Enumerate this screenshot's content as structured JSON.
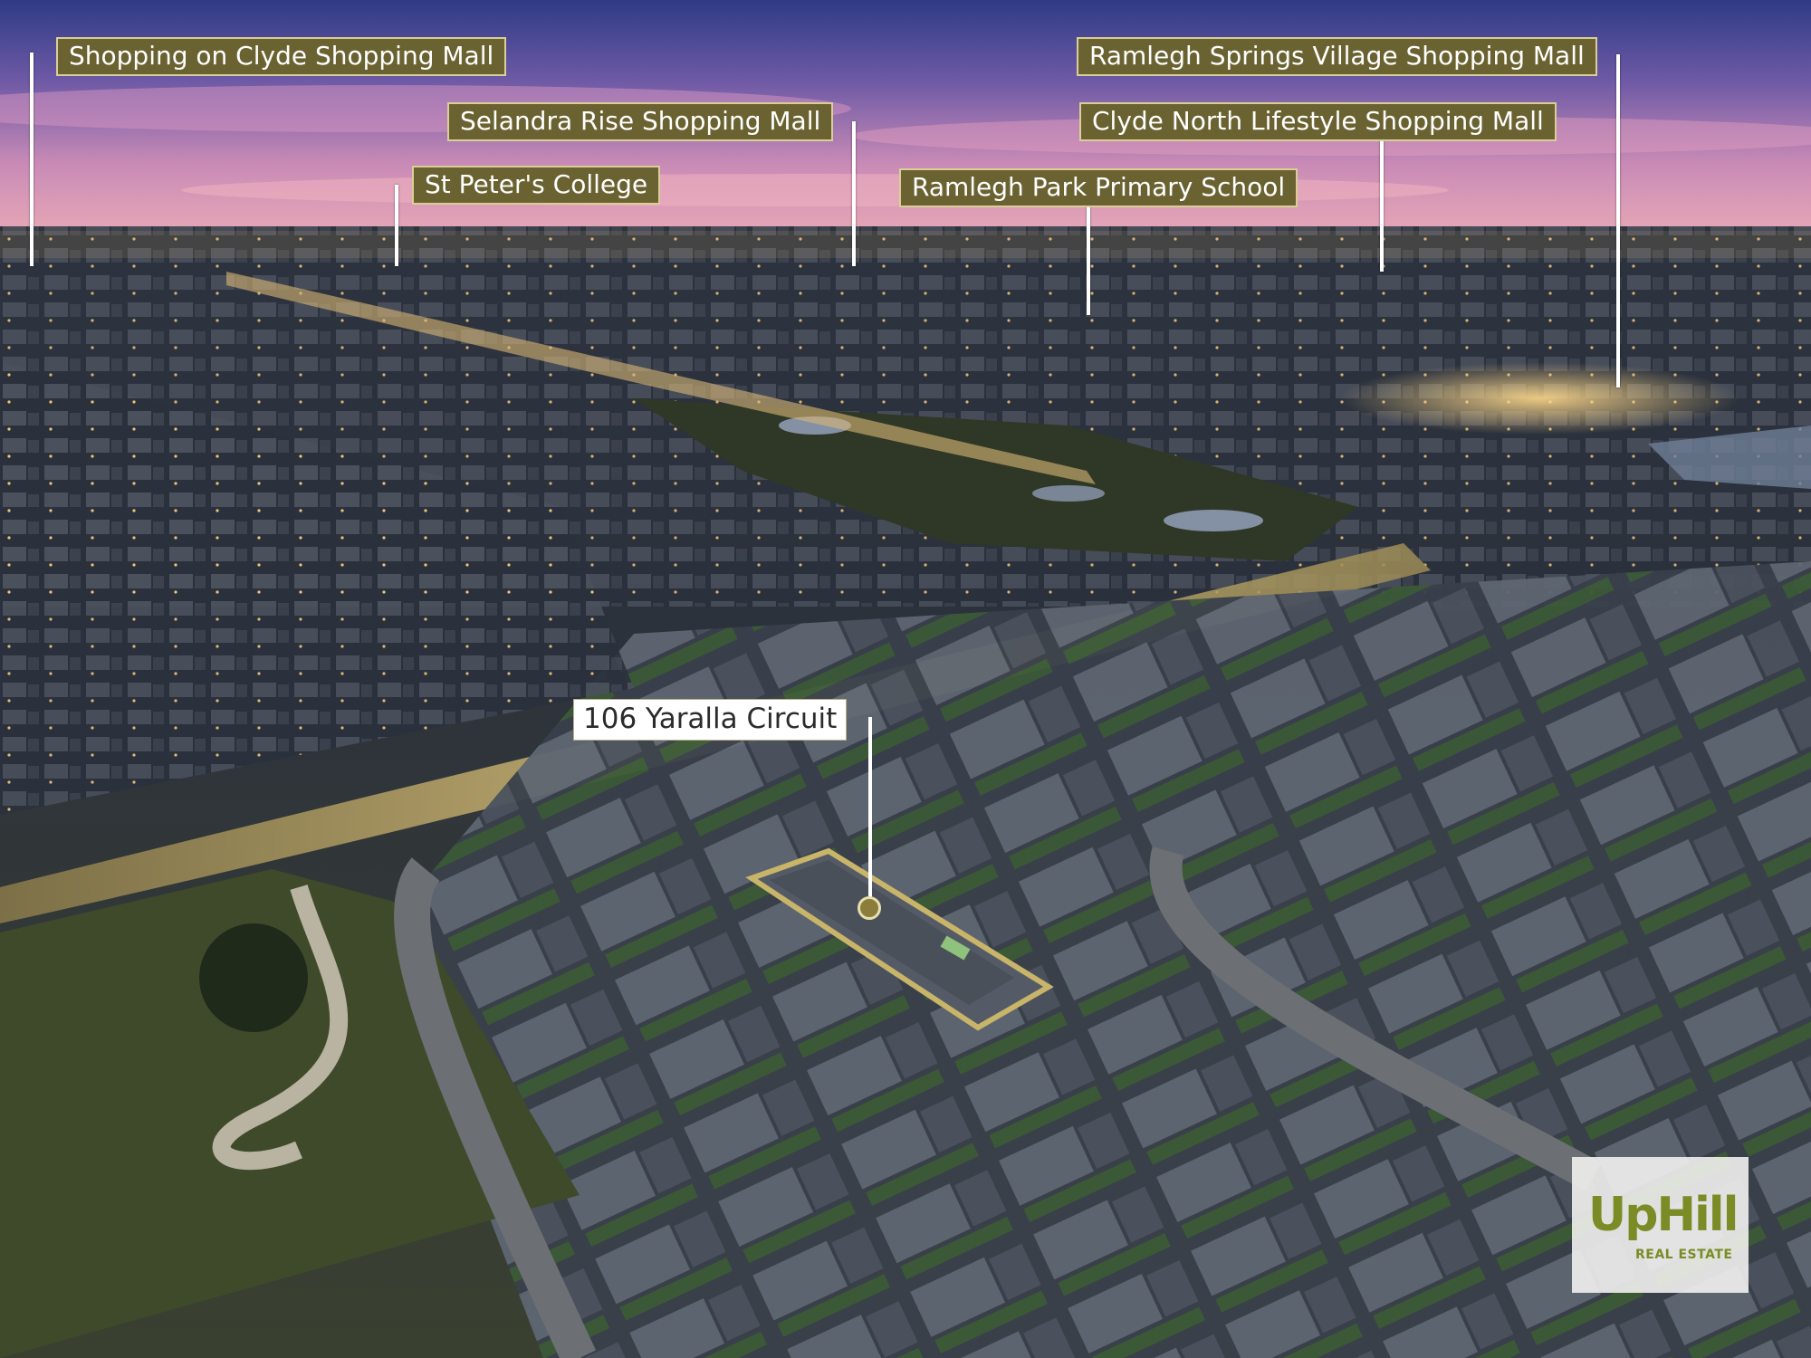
{
  "image": {
    "description_colors": {
      "sky_top": "#3a3f8f",
      "sky_mid": "#8e6aa8",
      "horizon": "#e6a3b4",
      "city": "#2a2f3a",
      "label_fill": "#6b6231",
      "label_border": "#d9cf96",
      "highlight_outline": "#c8b56a"
    }
  },
  "labels": [
    {
      "text": "Shopping on Clyde Shopping Mall"
    },
    {
      "text": "Selandra Rise Shopping Mall"
    },
    {
      "text": "St Peter's College"
    },
    {
      "text": "Ramlegh Springs Village Shopping Mall"
    },
    {
      "text": "Clyde North Lifestyle Shopping Mall"
    },
    {
      "text": "Ramlegh Park Primary School"
    }
  ],
  "property": {
    "address": "106 Yaralla Circuit"
  },
  "logo": {
    "mark": "UpHill",
    "subtitle": "REAL ESTATE"
  }
}
